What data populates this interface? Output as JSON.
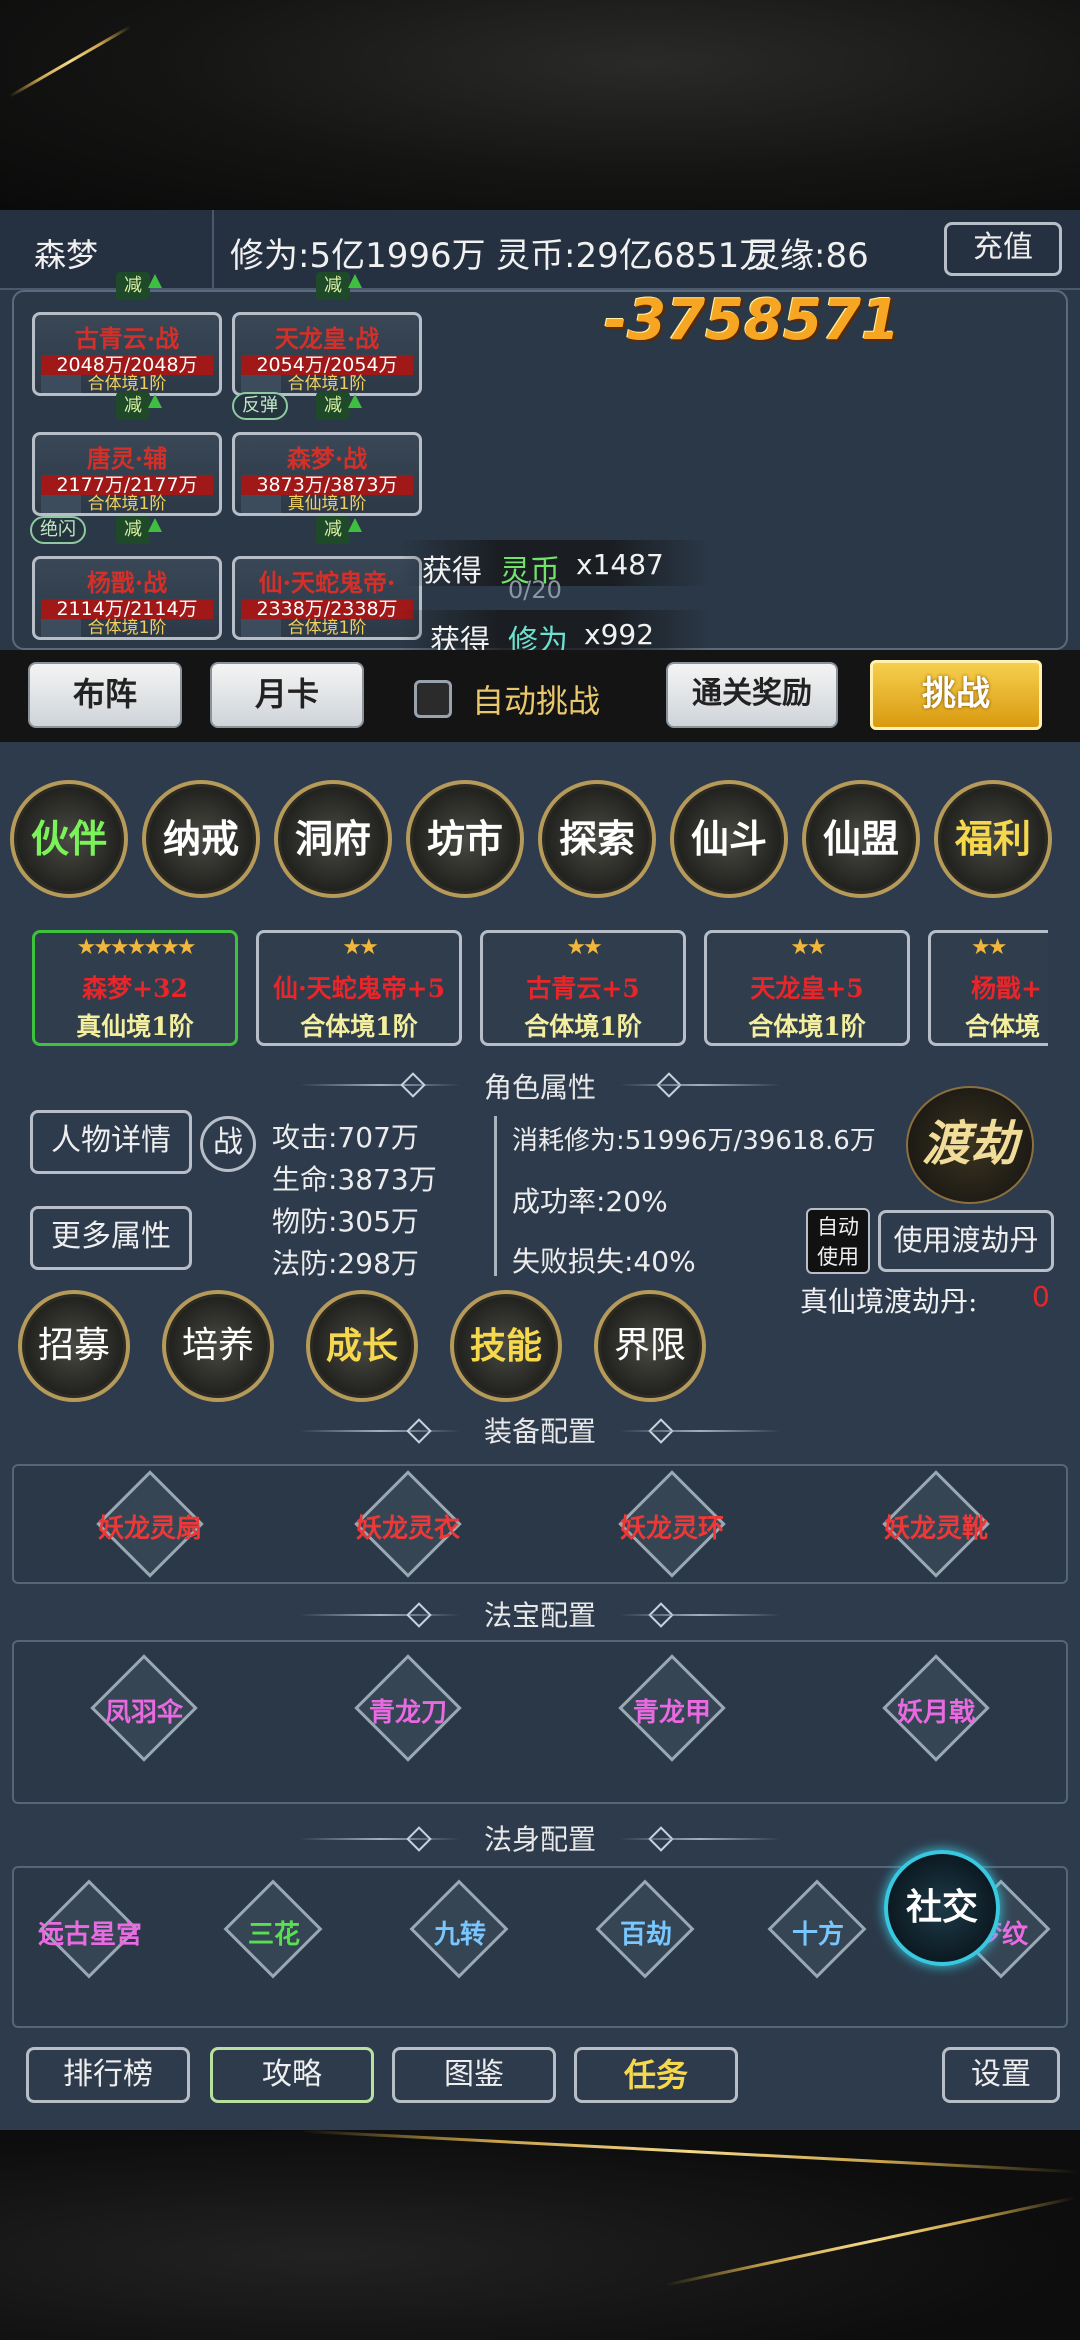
{
  "topbar": {
    "player": "森梦",
    "cultivation": "修为:5亿1996万",
    "spirit": "灵币:29亿6851万",
    "fate": "灵缘:86",
    "recharge": "充值"
  },
  "battle": {
    "damage": "-3758571",
    "debuff": "减",
    "units": [
      {
        "name": "古青云·战",
        "hp": "2048万/2048万",
        "level": "合体境1阶"
      },
      {
        "name": "天龙皇·战",
        "hp": "2054万/2054万",
        "level": "合体境1阶"
      },
      {
        "name": "唐灵·辅",
        "hp": "2177万/2177万",
        "level": "合体境1阶"
      },
      {
        "name": "森梦·战",
        "hp": "3873万/3873万",
        "level": "真仙境1阶"
      },
      {
        "name": "杨戬·战",
        "hp": "2114万/2114万",
        "level": "合体境1阶"
      },
      {
        "name": "仙·天蛇鬼帝·",
        "hp": "2338万/2338万",
        "level": "合体境1阶"
      }
    ],
    "tag_rebound": "反弹",
    "tag_dodge": "绝闪",
    "counter": "0/20",
    "gain1": {
      "label": "获得",
      "item": "灵币",
      "qty": "x1487"
    },
    "gain2": {
      "label": "获得",
      "item": "修为",
      "qty": "x992"
    }
  },
  "actions": {
    "formation": "布阵",
    "monthcard": "月卡",
    "auto": "自动挑战",
    "clear_reward": "通关奖励",
    "challenge": "挑战"
  },
  "menu": [
    "伙伴",
    "纳戒",
    "洞府",
    "坊市",
    "探索",
    "仙斗",
    "仙盟",
    "福利"
  ],
  "partners": [
    {
      "stars": "★★★★★★★",
      "name": "森梦+32",
      "realm": "真仙境1阶"
    },
    {
      "stars": "★★",
      "name": "仙·天蛇鬼帝+5",
      "realm": "合体境1阶"
    },
    {
      "stars": "★★",
      "name": "古青云+5",
      "realm": "合体境1阶"
    },
    {
      "stars": "★★",
      "name": "天龙皇+5",
      "realm": "合体境1阶"
    },
    {
      "stars": "★★",
      "name": "杨戬+",
      "realm": "合体境"
    }
  ],
  "attr": {
    "title": "角色属性",
    "detail": "人物详情",
    "war": "战",
    "more": "更多属性",
    "atk": "攻击:707万",
    "hp": "生命:3873万",
    "pdef": "物防:305万",
    "mdef": "法防:298万",
    "cost": "消耗修为:51996万/39618.6万",
    "success": "成功率:20%",
    "fail": "失败损失:40%",
    "tribulation": "渡劫",
    "auto_use": "自动使用",
    "use_pill": "使用渡劫丹",
    "pill_label": "真仙境渡劫丹:",
    "pill_count": "0"
  },
  "sub": [
    "招募",
    "培养",
    "成长",
    "技能",
    "界限"
  ],
  "equip": {
    "title": "装备配置",
    "items": [
      "妖龙灵扇",
      "妖龙灵衣",
      "妖龙灵环",
      "妖龙灵靴"
    ]
  },
  "treasure": {
    "title": "法宝配置",
    "items": [
      "凤羽伞",
      "青龙刀",
      "青龙甲",
      "妖月戟"
    ]
  },
  "body": {
    "title": "法身配置",
    "items": [
      "远古星宫",
      "三花",
      "九转",
      "百劫",
      "十方",
      "梦纹"
    ]
  },
  "social": "社交",
  "bottom": {
    "rank": "排行榜",
    "guide": "攻略",
    "atlas": "图鉴",
    "task": "任务",
    "settings": "设置"
  }
}
